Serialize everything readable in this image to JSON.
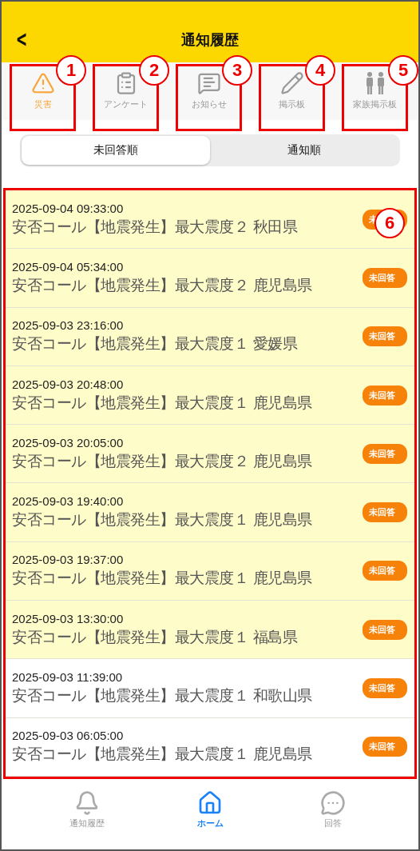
{
  "header": {
    "back": "<",
    "title": "通知履歴"
  },
  "categories": [
    {
      "label": "災害",
      "kind": "warning",
      "selected": true,
      "callout": "1"
    },
    {
      "label": "アンケート",
      "kind": "clipboard",
      "selected": false,
      "callout": "2"
    },
    {
      "label": "お知らせ",
      "kind": "message",
      "selected": false,
      "callout": "3"
    },
    {
      "label": "掲示板",
      "kind": "pencil",
      "selected": false,
      "callout": "4"
    },
    {
      "label": "家族掲示板",
      "kind": "family",
      "selected": false,
      "callout": "5"
    }
  ],
  "sort_tabs": [
    {
      "label": "未回答順",
      "selected": true
    },
    {
      "label": "通知順",
      "selected": false
    }
  ],
  "list_callout": "6",
  "notifications": [
    {
      "datetime": "2025-09-04 09:33:00",
      "title": "安否コール【地震発生】最大震度２ 秋田県",
      "badge": "未",
      "highlighted": true
    },
    {
      "datetime": "2025-09-04 05:34:00",
      "title": "安否コール【地震発生】最大震度２ 鹿児島県",
      "badge": "未回答",
      "highlighted": true
    },
    {
      "datetime": "2025-09-03 23:16:00",
      "title": "安否コール【地震発生】最大震度１ 愛媛県",
      "badge": "未回答",
      "highlighted": true
    },
    {
      "datetime": "2025-09-03 20:48:00",
      "title": "安否コール【地震発生】最大震度１ 鹿児島県",
      "badge": "未回答",
      "highlighted": true
    },
    {
      "datetime": "2025-09-03 20:05:00",
      "title": "安否コール【地震発生】最大震度２ 鹿児島県",
      "badge": "未回答",
      "highlighted": true
    },
    {
      "datetime": "2025-09-03 19:40:00",
      "title": "安否コール【地震発生】最大震度１ 鹿児島県",
      "badge": "未回答",
      "highlighted": true
    },
    {
      "datetime": "2025-09-03 19:37:00",
      "title": "安否コール【地震発生】最大震度１ 鹿児島県",
      "badge": "未回答",
      "highlighted": true
    },
    {
      "datetime": "2025-09-03 13:30:00",
      "title": "安否コール【地震発生】最大震度１ 福島県",
      "badge": "未回答",
      "highlighted": true
    },
    {
      "datetime": "2025-09-03 11:39:00",
      "title": "安否コール【地震発生】最大震度１ 和歌山県",
      "badge": "未回答",
      "highlighted": false
    },
    {
      "datetime": "2025-09-03 06:05:00",
      "title": "安否コール【地震発生】最大震度１ 鹿児島県",
      "badge": "未回答",
      "highlighted": false
    }
  ],
  "bottom_nav": [
    {
      "label": "通知履歴",
      "kind": "bell",
      "selected": false
    },
    {
      "label": "ホーム",
      "kind": "home",
      "selected": true
    },
    {
      "label": "回答",
      "kind": "chat",
      "selected": false
    }
  ]
}
